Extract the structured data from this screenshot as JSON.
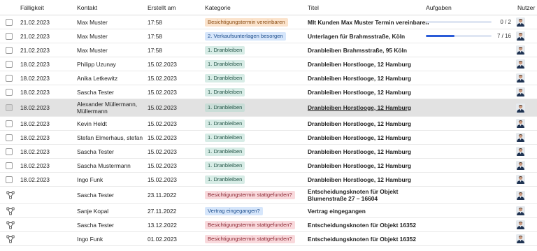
{
  "header": {
    "due": "Fälligkeit",
    "contact": "Kontakt",
    "created": "Erstellt am",
    "category": "Kategorie",
    "title": "Titel",
    "tasks": "Aufgaben",
    "user": "Nutzer"
  },
  "rows": [
    {
      "icon": "checkbox",
      "due": "21.02.2023",
      "contact": "Max Muster",
      "created": "17:58",
      "category": "Besichtigungstermin vereinbaren",
      "category_color": "orange",
      "title": "MIt Kunden Max Muster Termin vereinbaren",
      "tasks": {
        "text": "0 / 2",
        "done": 0,
        "total": 2
      }
    },
    {
      "icon": "checkbox",
      "due": "21.02.2023",
      "contact": "Max Muster",
      "created": "17:58",
      "category": "2. Verkaufsunterlagen besorgen",
      "category_color": "blue",
      "title": "Unterlagen für Brahmsstraße, Köln",
      "tasks": {
        "text": "7 / 16",
        "done": 7,
        "total": 16
      }
    },
    {
      "icon": "checkbox",
      "due": "21.02.2023",
      "contact": "Max Muster",
      "created": "17:58",
      "category": "1. Dranbleiben",
      "category_color": "teal",
      "title": "Dranbleiben Brahmsstraße, 95 Köln"
    },
    {
      "icon": "checkbox",
      "due": "18.02.2023",
      "contact": "Philipp Uzunay",
      "created": "15.02.2023",
      "category": "1. Dranbleiben",
      "category_color": "teal",
      "title": "Dranbleiben Horstlooge, 12 Hamburg"
    },
    {
      "icon": "checkbox",
      "due": "18.02.2023",
      "contact": "Anika Letkewitz",
      "created": "15.02.2023",
      "category": "1. Dranbleiben",
      "category_color": "teal",
      "title": "Dranbleiben Horstlooge, 12 Hamburg"
    },
    {
      "icon": "checkbox",
      "due": "18.02.2023",
      "contact": "Sascha Tester",
      "created": "15.02.2023",
      "category": "1. Dranbleiben",
      "category_color": "teal",
      "title": "Dranbleiben Horstlooge, 12 Hamburg"
    },
    {
      "icon": "checkbox",
      "due": "18.02.2023",
      "contact": "Alexander Müllermann, Müllermann",
      "created": "15.02.2023",
      "category": "1. Dranbleiben",
      "category_color": "teal",
      "title": "Dranbleiben Horstlooge, 12 Hamburg",
      "selected": true
    },
    {
      "icon": "checkbox",
      "due": "18.02.2023",
      "contact": "Kevin Heldt",
      "created": "15.02.2023",
      "category": "1. Dranbleiben",
      "category_color": "teal",
      "title": "Dranbleiben Horstlooge, 12 Hamburg"
    },
    {
      "icon": "checkbox",
      "due": "18.02.2023",
      "contact": "Stefan Elmerhaus, stefan",
      "created": "15.02.2023",
      "category": "1. Dranbleiben",
      "category_color": "teal",
      "title": "Dranbleiben Horstlooge, 12 Hamburg"
    },
    {
      "icon": "checkbox",
      "due": "18.02.2023",
      "contact": "Sascha Tester",
      "created": "15.02.2023",
      "category": "1. Dranbleiben",
      "category_color": "teal",
      "title": "Dranbleiben Horstlooge, 12 Hamburg"
    },
    {
      "icon": "checkbox",
      "due": "18.02.2023",
      "contact": "Sascha Mustermann",
      "created": "15.02.2023",
      "category": "1. Dranbleiben",
      "category_color": "teal",
      "title": "Dranbleiben Horstlooge, 12 Hamburg"
    },
    {
      "icon": "checkbox",
      "due": "18.02.2023",
      "contact": "Ingo Funk",
      "created": "15.02.2023",
      "category": "1. Dranbleiben",
      "category_color": "teal",
      "title": "Dranbleiben Horstlooge, 12 Hamburg"
    },
    {
      "icon": "workflow",
      "due": "",
      "contact": "Sascha Tester",
      "created": "23.11.2022",
      "category": "Besichtigungstermin stattgefunden?",
      "category_color": "red",
      "title": "Entscheidungsknoten für Objekt Blumenstraße 27 – 16604"
    },
    {
      "icon": "workflow",
      "due": "",
      "contact": "Sanje Kopal",
      "created": "27.11.2022",
      "category": "Vertrag eingegangen?",
      "category_color": "blue",
      "title": "Vertrag eingegangen"
    },
    {
      "icon": "workflow",
      "due": "",
      "contact": "Sascha Tester",
      "created": "13.12.2022",
      "category": "Besichtigungstermin stattgefunden?",
      "category_color": "red",
      "title": "Entscheidungsknoten für Objekt 16352"
    },
    {
      "icon": "workflow",
      "due": "",
      "contact": "Ingo Funk",
      "created": "01.02.2023",
      "category": "Besichtigungstermin stattgefunden?",
      "category_color": "red",
      "title": "Entscheidungsknoten für Objekt 16352"
    }
  ]
}
